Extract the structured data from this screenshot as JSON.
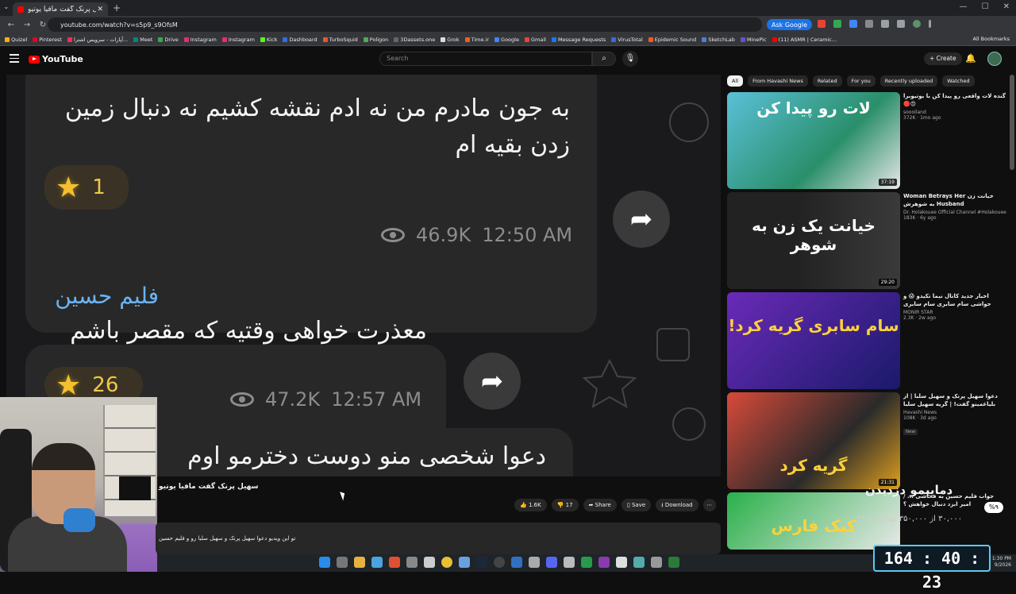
{
  "browser": {
    "tab_title": "سهیل پرنک گفت مافیا یوتیو...",
    "url": "youtube.com/watch?v=s5p9_s9OfsM",
    "ask_google": "Ask Google",
    "bookmarks": [
      "Quizel",
      "Pinterest",
      "آپارات - سرویس اشترا...",
      "Meet",
      "Drive",
      "Instagram",
      "Instagram",
      "Kick",
      "Dashboard",
      "TurboSquid",
      "Poligon",
      "3Dassets.one",
      "Grok",
      "Time.ir",
      "Google",
      "Gmail",
      "Message Requests",
      "VirusTotal",
      "Epidemic Sound",
      "SketchLab",
      "MinePic",
      "(11) ASMR | Ceramic..."
    ],
    "all_bookmarks": "All Bookmarks"
  },
  "youtube": {
    "logo_text": "YouTube",
    "search_placeholder": "Search",
    "create_label": "Create"
  },
  "video": {
    "message1": "به جون مادرم من نه ادم نقشه کشیم نه دنبال زمین زدن بقیه ام",
    "reaction1_count": "1",
    "views1": "46.9K",
    "time1": "12:50 AM",
    "sender2": "فلیم حسین",
    "message2": "معذرت خواهی وقتیه که مقصر باشم",
    "reaction2_count": "26",
    "views2": "47.2K",
    "time2": "12:57 AM",
    "message3": "دعوا شخصی منو دوست دخترمو اوم"
  },
  "video_info": {
    "title": "سهیل پرنک گفت مافیا یوتیو",
    "likes": "1.6K",
    "dislikes": "17",
    "share": "Share",
    "save": "Save",
    "download": "Download",
    "description": "تو این ویدیو دعوا سهیل پرنک و سهیل سلبا رو و فلیم حسین"
  },
  "chips": [
    "All",
    "From Havashi News",
    "Related",
    "For you",
    "Recently uploaded",
    "Watched"
  ],
  "recommendations": [
    {
      "title": "گنده لات واقعی رو پیدا کن با یوتیوبرا 😍🔴",
      "channel": "soooiland",
      "views": "372K · 1mo ago",
      "duration": "37:19",
      "thumb_text": "لات رو پیدا کن"
    },
    {
      "title": "خیانت زن Woman Betrays Her Husband به شوهرش",
      "channel": "Dr. Holakouee Official Channel #Holakouee",
      "views": "183K · 6y ago",
      "duration": "29:20",
      "thumb_text": "خیانت یک زن به شوهر"
    },
    {
      "title": "اخبار جدید کانال نیما تکیدو 😱 و حواشی سام سابری سام سابری",
      "channel": "MONIR STAR",
      "views": "2.3K · 2w ago",
      "duration": "",
      "thumb_text": "سام سابری گریه کرد!"
    },
    {
      "title": "دعوا سهیل پرنک و سهیل سلبا | از بلیاغمینو گفت! | گریه سهیل سلبا",
      "channel": "Havashi News",
      "views": "108K · 3d ago",
      "badge": "New",
      "duration": "21:31",
      "thumb_text": "گریه کرد"
    },
    {
      "title": "جواب فلیم حسین به فحاشی ... / امیر ابزد دنبال خواهش ؟",
      "channel": "",
      "views": "",
      "duration": "",
      "thumb_text": "کیک فارس"
    }
  ],
  "overlay": {
    "donation_text": "دمایپمو دزدیدن",
    "progress_text": "۳۰,۰۰۰ از ۳۵۰,۰۰۰ تومان (%۹)",
    "progress_fraction": 0.09,
    "pct_badge": "%۹",
    "timer": "164 : 40 : 23"
  },
  "taskbar": {
    "clock_time": "1:30 PM",
    "clock_date": "9/2026"
  },
  "colors": {
    "youtube_red": "#ff0000",
    "background": "#0f0f0f",
    "sender_blue": "#6ab4f5",
    "reaction_gold": "#f5c030",
    "timer_border": "#5ec8ee"
  }
}
